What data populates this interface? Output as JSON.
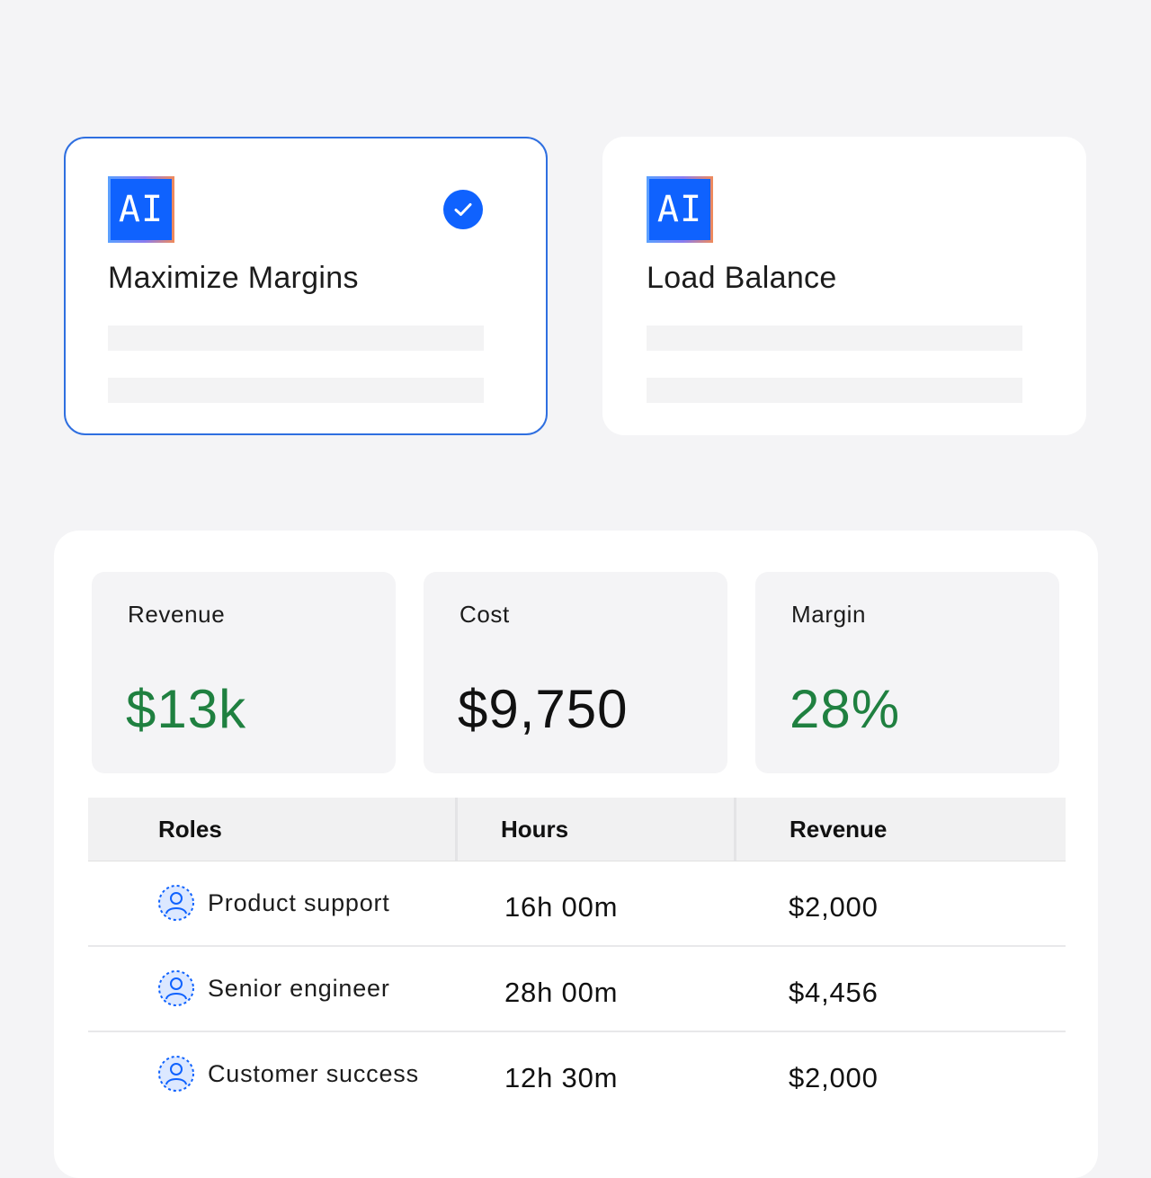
{
  "options": [
    {
      "badge": "AI",
      "title": "Maximize Margins",
      "selected": true,
      "check_icon": "checkmark-circle-icon"
    },
    {
      "badge": "AI",
      "title": "Load Balance",
      "selected": false
    }
  ],
  "metrics": [
    {
      "label": "Revenue",
      "value": "$13k",
      "color": "#1f8040"
    },
    {
      "label": "Cost",
      "value": "$9,750",
      "color": "#111111"
    },
    {
      "label": "Margin",
      "value": "28%",
      "color": "#1f8040"
    }
  ],
  "table": {
    "headers": [
      "Roles",
      "Hours",
      "Revenue"
    ],
    "rows": [
      {
        "role": "Product support",
        "hours": "16h 00m",
        "revenue": "$2,000",
        "icon": "user-avatar-icon"
      },
      {
        "role": "Senior engineer",
        "hours": "28h 00m",
        "revenue": "$4,456",
        "icon": "user-avatar-icon"
      },
      {
        "role": "Customer success",
        "hours": "12h 30m",
        "revenue": "$2,000",
        "icon": "user-avatar-icon"
      }
    ]
  },
  "colors": {
    "accent": "#0f62fe",
    "positive": "#1f8040",
    "background": "#f4f4f6"
  }
}
